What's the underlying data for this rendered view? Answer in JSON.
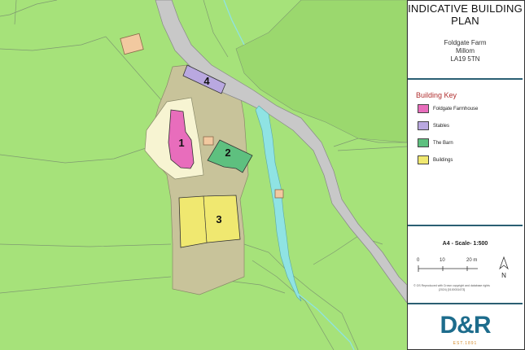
{
  "title_block": {
    "title": "INDICATIVE BUILDING PLAN",
    "farm": "Foldgate Farm",
    "town": "Millom",
    "postcode": "LA19 5TN"
  },
  "key": {
    "heading": "Building Key",
    "items": [
      {
        "label": "Foldgate Farmhouse",
        "color": "#e86dbc"
      },
      {
        "label": "Stables",
        "color": "#b9a8e0"
      },
      {
        "label": "The Barn",
        "color": "#5ec07f"
      },
      {
        "label": "Buildings",
        "color": "#f0e870"
      }
    ]
  },
  "scale": {
    "label": "A4 - Scale- 1:500",
    "ticks": [
      "0",
      "10",
      "20 m"
    ],
    "north": "N",
    "copyright": "© OS Reproduced with Crown copyright and database rights (2024) [0100031673]"
  },
  "map": {
    "building_numbers": [
      "1",
      "2",
      "3",
      "4"
    ],
    "colors": {
      "grass": "#a6e27a",
      "yard": "#c8c39a",
      "garden": "#f7f4d2",
      "road": "#c8c8c8",
      "stream": "#8fe3e3",
      "pink": "#e86dbc",
      "purple": "#b9a8e0",
      "green": "#5ec07f",
      "yellow": "#f0e870",
      "orange": "#f2c9a0"
    }
  },
  "logo": {
    "text": "D&R",
    "est": "EST.1891"
  }
}
